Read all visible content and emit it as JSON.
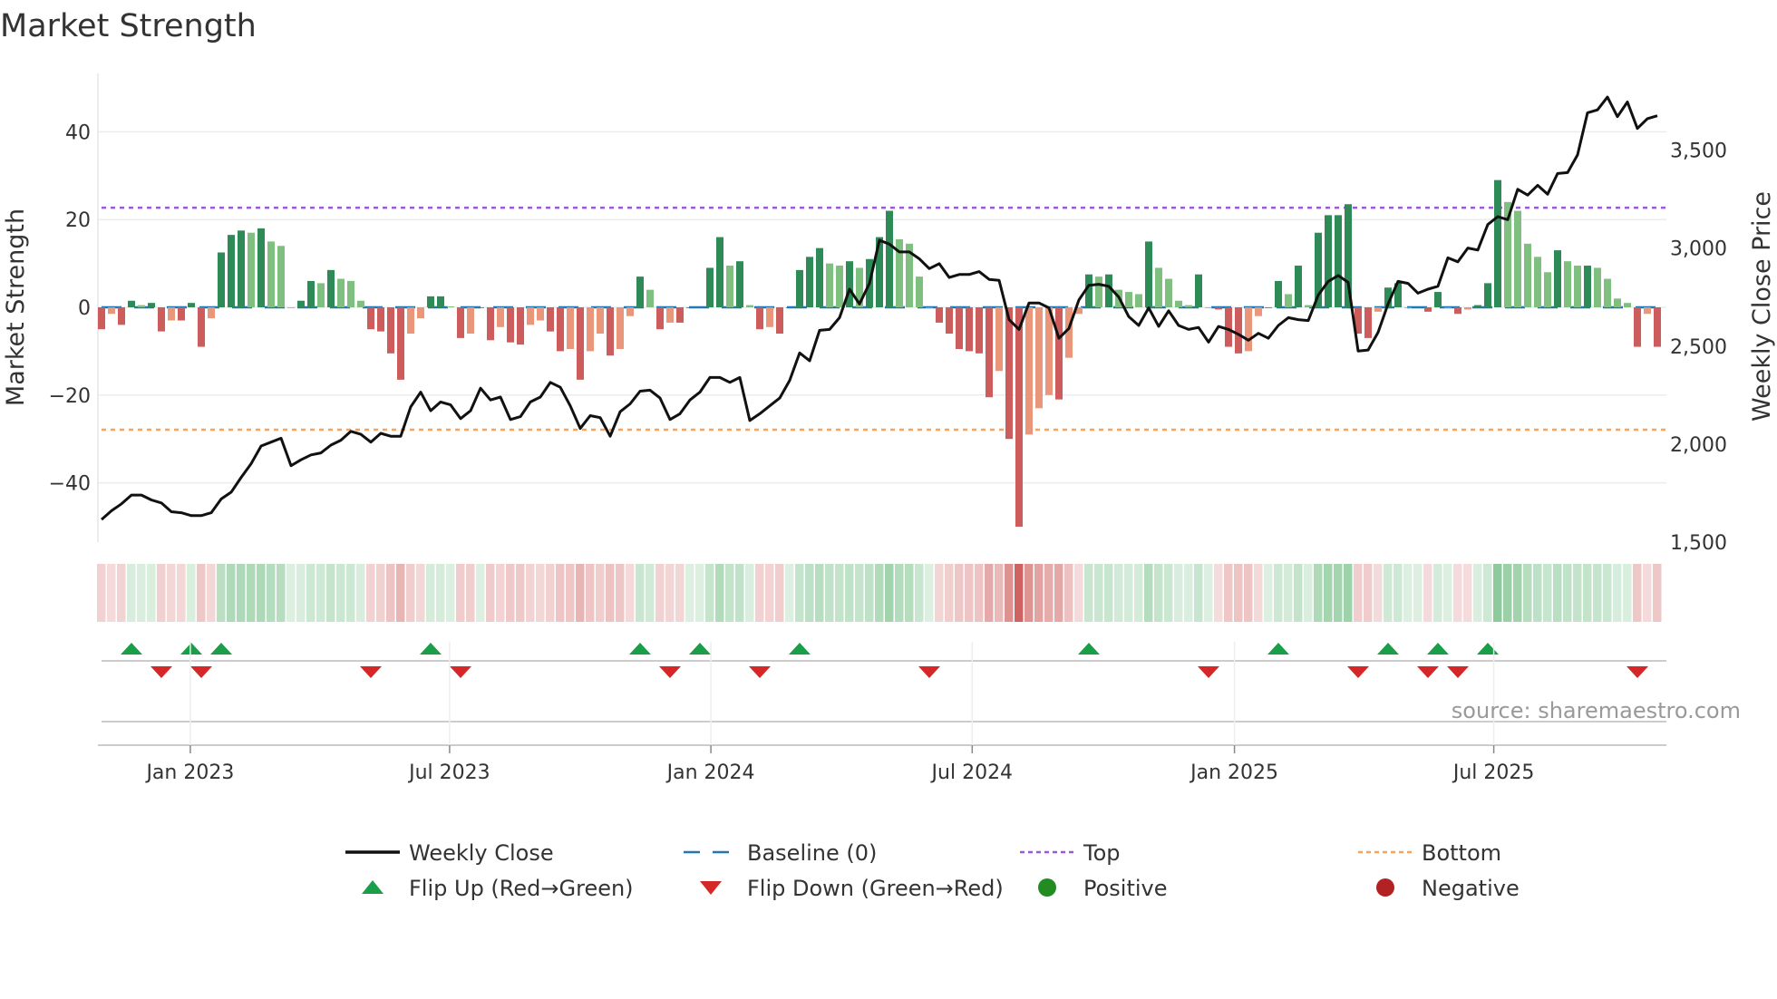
{
  "chart_data": {
    "type": "bar",
    "title": "Market Strength",
    "ylabel": "Market Strength",
    "y2label": "Weekly Close Price",
    "source": "source: sharemaestro.com",
    "ylim": [
      -55,
      56
    ],
    "y2lim": [
      1500,
      3840
    ],
    "yticks": [
      {
        "v": 40,
        "label": "40"
      },
      {
        "v": 20,
        "label": "20"
      },
      {
        "v": 0,
        "label": "0"
      },
      {
        "v": -20,
        "label": "−20"
      },
      {
        "v": -40,
        "label": "−40"
      }
    ],
    "y2ticks": [
      {
        "v": 3500,
        "label": "3,500"
      },
      {
        "v": 3000,
        "label": "3,000"
      },
      {
        "v": 2500,
        "label": "2,500"
      },
      {
        "v": 2000,
        "label": "2,000"
      },
      {
        "v": 1500,
        "label": "1,500"
      }
    ],
    "xticks": [
      {
        "week": 8.9,
        "label": "Jan 2023"
      },
      {
        "week": 34.9,
        "label": "Jul 2023"
      },
      {
        "week": 61.1,
        "label": "Jan 2024"
      },
      {
        "week": 87.3,
        "label": "Jul 2024"
      },
      {
        "week": 113.6,
        "label": "Jan 2025"
      },
      {
        "week": 139.6,
        "label": "Jul 2025"
      }
    ],
    "thresholds": {
      "top": 22.7,
      "bottom": -27.9,
      "baseline": 0
    },
    "strength": [
      -5,
      -1.5,
      -4,
      1.5,
      0.5,
      1,
      -5.5,
      -3,
      -3,
      1,
      -9,
      -2.5,
      12.5,
      16.5,
      17.5,
      17,
      18,
      15,
      14,
      0,
      1.5,
      6,
      5.5,
      8.5,
      6.5,
      6,
      1.5,
      -5,
      -5.5,
      -10.5,
      -16.5,
      -6,
      -2.5,
      2.5,
      2.5,
      0.2,
      -7,
      -6,
      0,
      -7.5,
      -4.5,
      -8,
      -8.5,
      -4,
      -3,
      -5.5,
      -10,
      -9.5,
      -16.5,
      -10,
      -6,
      -11,
      -9.5,
      -2,
      7,
      4,
      -5,
      -3.5,
      -3.5,
      0,
      0,
      9,
      16,
      9.5,
      10.5,
      0.5,
      -5,
      -4.5,
      -6,
      0,
      8.5,
      11.5,
      13.5,
      10,
      9.5,
      10.5,
      9,
      11,
      16,
      22,
      15.5,
      14.5,
      7,
      0,
      -3.5,
      -6,
      -9.5,
      -10,
      -10.5,
      -20.5,
      -14.5,
      -30,
      -50,
      -29,
      -23,
      -20,
      -21,
      -11.5,
      -1.5,
      7.5,
      7,
      7.5,
      4,
      3.5,
      3,
      15,
      9,
      6.5,
      1.5,
      0.5,
      7.5,
      0,
      -0.5,
      -9,
      -10.5,
      -10,
      -2,
      0,
      6,
      3,
      9.5,
      0.5,
      17,
      21,
      21,
      23.5,
      -6,
      -7,
      -1,
      4.5,
      5.5,
      0,
      0,
      -1,
      3.5,
      0,
      -1.5,
      -0.5,
      0.5,
      5.5,
      29,
      24,
      22,
      14.5,
      11.5,
      8,
      13,
      10.5,
      9.5,
      9.5,
      9,
      6.5,
      2,
      1,
      -9,
      -1.5,
      -9
    ],
    "weekly_close": [
      1615,
      1660,
      1695,
      1740,
      1740,
      1715,
      1700,
      1655,
      1650,
      1635,
      1635,
      1650,
      1720,
      1755,
      1830,
      1900,
      1990,
      2010,
      2030,
      1890,
      1920,
      1945,
      1955,
      1995,
      2020,
      2065,
      2050,
      2010,
      2055,
      2040,
      2040,
      2190,
      2265,
      2170,
      2215,
      2200,
      2130,
      2170,
      2285,
      2225,
      2240,
      2125,
      2140,
      2215,
      2240,
      2315,
      2290,
      2195,
      2080,
      2145,
      2135,
      2040,
      2165,
      2205,
      2270,
      2275,
      2235,
      2125,
      2155,
      2225,
      2265,
      2340,
      2340,
      2315,
      2340,
      2120,
      2155,
      2195,
      2235,
      2325,
      2465,
      2425,
      2580,
      2585,
      2645,
      2790,
      2715,
      2820,
      3040,
      3020,
      2980,
      2980,
      2945,
      2895,
      2920,
      2850,
      2865,
      2865,
      2880,
      2840,
      2835,
      2635,
      2585,
      2720,
      2720,
      2695,
      2540,
      2590,
      2735,
      2810,
      2815,
      2805,
      2750,
      2650,
      2605,
      2695,
      2600,
      2680,
      2605,
      2585,
      2595,
      2520,
      2600,
      2585,
      2560,
      2530,
      2565,
      2540,
      2605,
      2645,
      2635,
      2630,
      2760,
      2830,
      2860,
      2825,
      2475,
      2480,
      2570,
      2715,
      2830,
      2820,
      2770,
      2790,
      2805,
      2950,
      2930,
      3000,
      2990,
      3120,
      3160,
      3145,
      3300,
      3270,
      3320,
      3275,
      3380,
      3385,
      3475,
      3690,
      3705,
      3770,
      3670,
      3745,
      3610,
      3660,
      3675
    ],
    "flip_up_weeks": [
      3,
      9,
      12,
      33,
      54,
      60,
      70,
      99,
      118,
      129,
      134,
      139
    ],
    "flip_down_weeks": [
      6,
      10,
      27,
      36,
      57,
      66,
      83,
      111,
      126,
      133,
      136,
      154
    ],
    "legend": [
      {
        "key": "close",
        "label": "Weekly Close"
      },
      {
        "key": "baseline",
        "label": "Baseline (0)"
      },
      {
        "key": "top",
        "label": "Top"
      },
      {
        "key": "bottom",
        "label": "Bottom"
      },
      {
        "key": "flipup",
        "label": "Flip Up (Red→Green)"
      },
      {
        "key": "flipdown",
        "label": "Flip Down (Green→Red)"
      },
      {
        "key": "positive",
        "label": "Positive"
      },
      {
        "key": "negative",
        "label": "Negative"
      }
    ],
    "colors": {
      "pos_rising": "#2e8b57",
      "pos_falling": "#7fbf7f",
      "neg_falling": "#cd5c5c",
      "neg_rising": "#e9967a",
      "close": "#111111",
      "baseline": "#1f77b4",
      "top": "#9b59d6",
      "bottom": "#f4a460",
      "flip_up": "#1a9e48",
      "flip_down": "#d62728",
      "positive": "#228b22",
      "negative": "#b22222"
    }
  }
}
